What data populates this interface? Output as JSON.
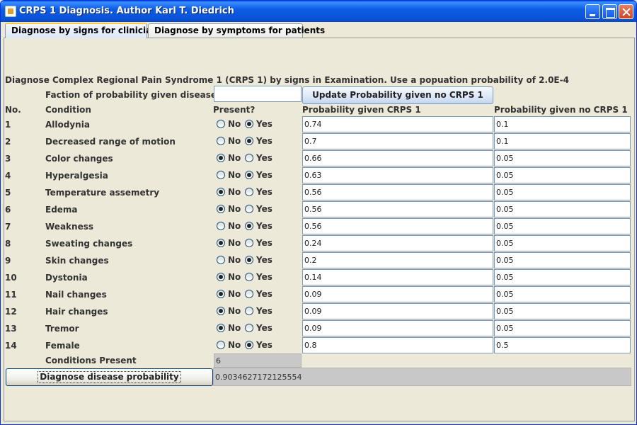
{
  "window": {
    "title": "CRPS 1 Diagnosis. Author Karl T. Diedrich"
  },
  "tabs": [
    {
      "label": "Diagnose by signs for clinicians",
      "active": true
    },
    {
      "label": "Diagnose by symptoms for patients",
      "active": false
    }
  ],
  "form": {
    "description": "Diagnose Complex Regional Pain Syndrome 1 (CRPS 1) by signs in Examination. Use a popuation probability of 2.0E-4",
    "fraction_label": "Faction of probability given disease",
    "fraction_value": "",
    "update_button": "Update Probability given no CRPS 1",
    "headers": {
      "no": "No.",
      "condition": "Condition",
      "present": "Present?",
      "prob_given": "Probability given CRPS 1",
      "prob_given_no": "Probability given no CRPS 1"
    },
    "radio_no_label": "No",
    "radio_yes_label": "Yes",
    "rows": [
      {
        "no": "1",
        "condition": "Allodynia",
        "present": "Yes",
        "p": "0.74",
        "pn": "0.1"
      },
      {
        "no": "2",
        "condition": "Decreased range of motion",
        "present": "Yes",
        "p": "0.7",
        "pn": "0.1"
      },
      {
        "no": "3",
        "condition": "Color changes",
        "present": "No",
        "p": "0.66",
        "pn": "0.05"
      },
      {
        "no": "4",
        "condition": "Hyperalgesia",
        "present": "Yes",
        "p": "0.63",
        "pn": "0.05"
      },
      {
        "no": "5",
        "condition": "Temperature assemetry",
        "present": "No",
        "p": "0.56",
        "pn": "0.05"
      },
      {
        "no": "6",
        "condition": "Edema",
        "present": "No",
        "p": "0.56",
        "pn": "0.05"
      },
      {
        "no": "7",
        "condition": "Weakness",
        "present": "Yes",
        "p": "0.56",
        "pn": "0.05"
      },
      {
        "no": "8",
        "condition": "Sweating changes",
        "present": "No",
        "p": "0.24",
        "pn": "0.05"
      },
      {
        "no": "9",
        "condition": "Skin changes",
        "present": "Yes",
        "p": "0.2",
        "pn": "0.05"
      },
      {
        "no": "10",
        "condition": "Dystonia",
        "present": "No",
        "p": "0.14",
        "pn": "0.05"
      },
      {
        "no": "11",
        "condition": "Nail changes",
        "present": "No",
        "p": "0.09",
        "pn": "0.05"
      },
      {
        "no": "12",
        "condition": "Hair changes",
        "present": "No",
        "p": "0.09",
        "pn": "0.05"
      },
      {
        "no": "13",
        "condition": "Tremor",
        "present": "No",
        "p": "0.09",
        "pn": "0.05"
      },
      {
        "no": "14",
        "condition": "Female",
        "present": "Yes",
        "p": "0.8",
        "pn": "0.5"
      }
    ],
    "conditions_present_label": "Conditions Present",
    "conditions_present_value": "6",
    "diagnose_button": "Diagnose disease probability",
    "result_value": "0.9034627172125554"
  }
}
